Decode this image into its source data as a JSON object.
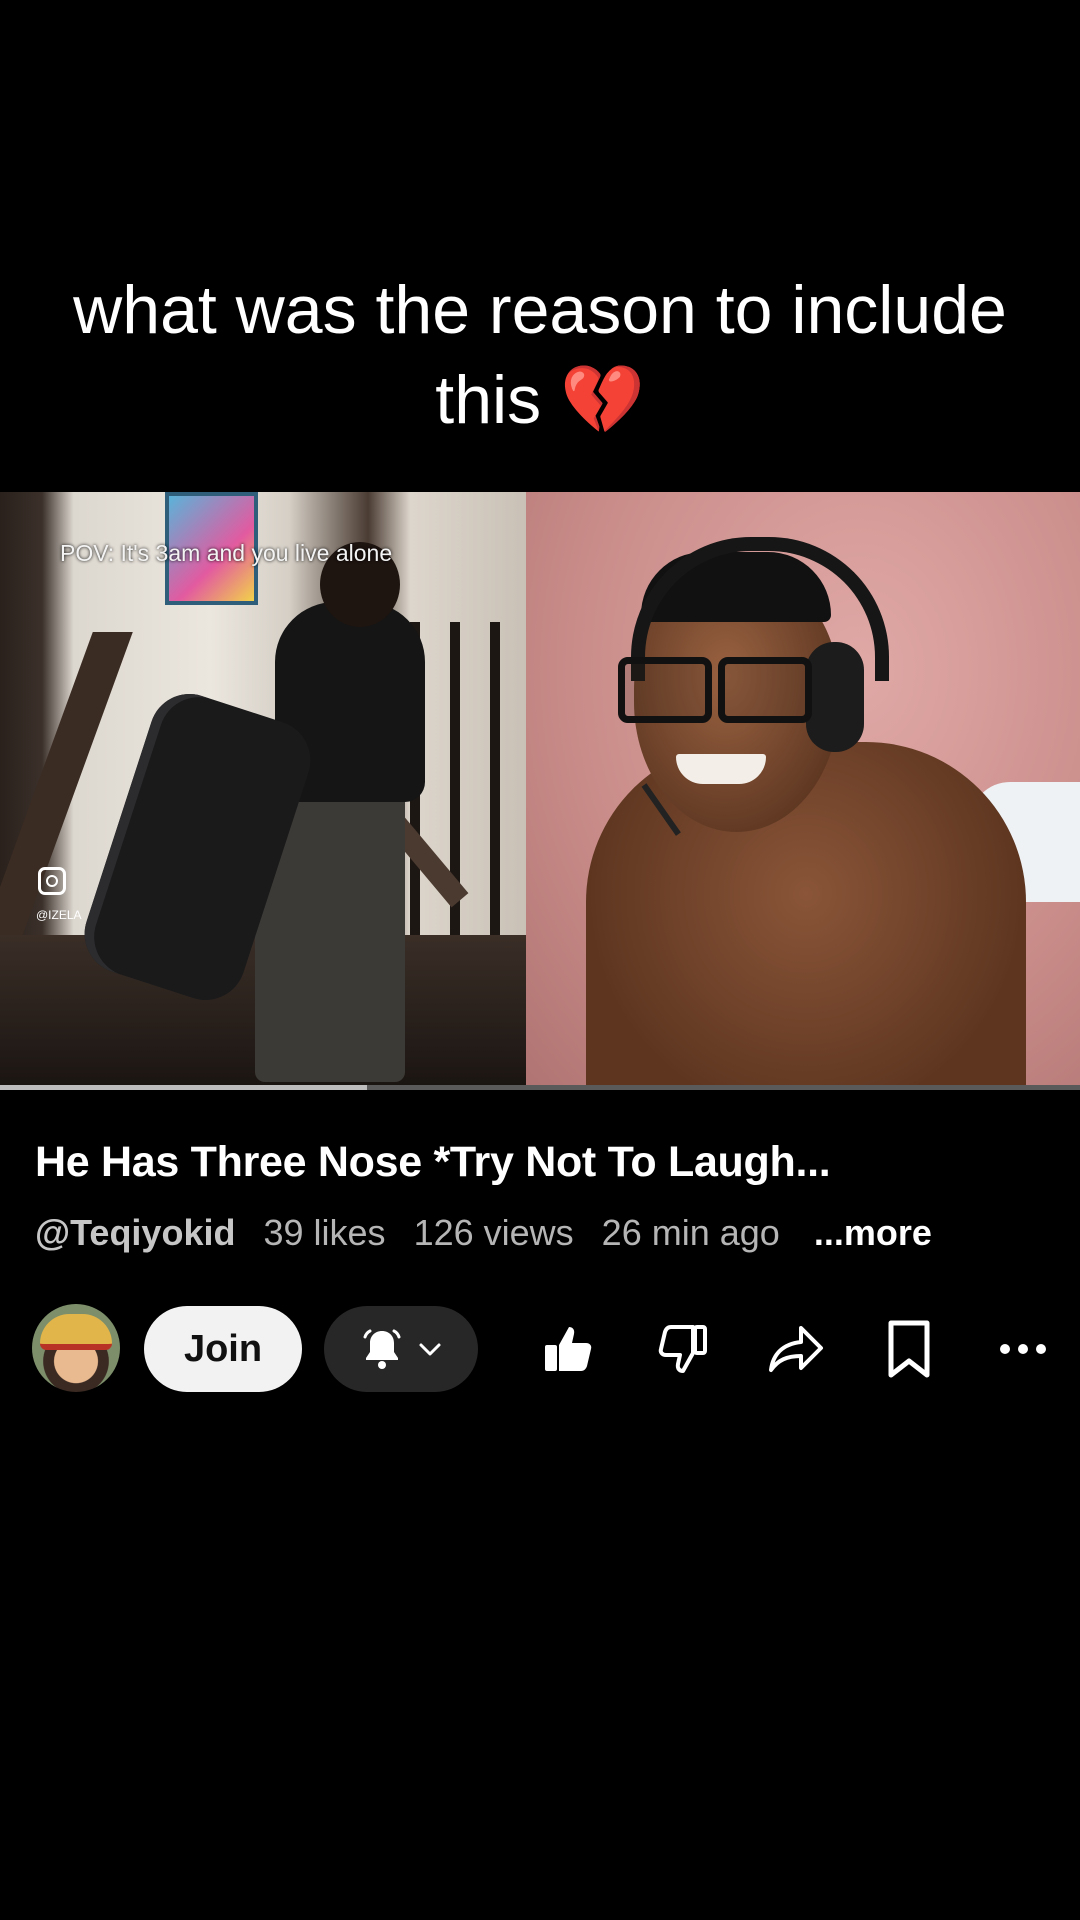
{
  "caption": {
    "text": "what was the reason to include this",
    "emoji": "💔"
  },
  "video": {
    "overlay_text": "POV: It's 3am and you live alone",
    "watermark_handle": "@IZELA",
    "progress": 0.34
  },
  "info": {
    "title": "He Has Three Nose *Try Not To Laugh...",
    "channel": "@Teqiyokid",
    "likes": "39 likes",
    "views": "126 views",
    "time": "26 min ago",
    "more": "...more"
  },
  "actions": {
    "join_label": "Join",
    "icons": [
      "bell-icon",
      "chevron-down-icon",
      "thumbs-up-icon",
      "thumbs-down-icon",
      "share-icon",
      "bookmark-icon",
      "more-icon"
    ]
  }
}
